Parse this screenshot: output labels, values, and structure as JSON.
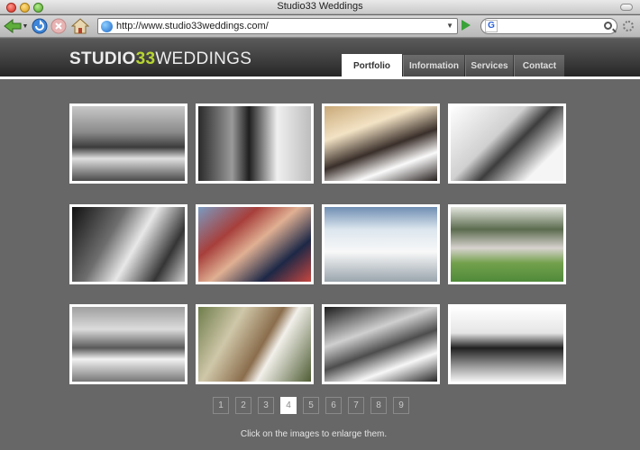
{
  "window": {
    "title": "Studio33 Weddings"
  },
  "toolbar": {
    "url": "http://www.studio33weddings.com/",
    "search_value": ""
  },
  "site": {
    "logo_part1": "STUDIO",
    "logo_part2": "33",
    "logo_part3": "WEDDINGS",
    "logo_colors": {
      "studio": "#ececec",
      "number": "#b7d532",
      "weddings": "#ececec"
    },
    "nav": [
      {
        "label": "Portfolio",
        "active": true
      },
      {
        "label": "Information",
        "active": false
      },
      {
        "label": "Services",
        "active": false
      },
      {
        "label": "Contact",
        "active": false
      }
    ]
  },
  "gallery": {
    "thumbnails": [
      "bw-photo",
      "bw-photo",
      "color-photo",
      "bw-photo",
      "bw-photo",
      "color-photo",
      "color-photo",
      "color-photo",
      "bw-photo",
      "color-photo",
      "bw-photo",
      "bw-photo"
    ]
  },
  "pagination": {
    "pages": [
      "1",
      "2",
      "3",
      "4",
      "5",
      "6",
      "7",
      "8",
      "9"
    ],
    "current": "4"
  },
  "footer": {
    "note": "Click on the images to enlarge them."
  },
  "colors": {
    "page_bg": "#676767",
    "accent": "#b7d532",
    "header_bg": "#3c3c3c"
  }
}
